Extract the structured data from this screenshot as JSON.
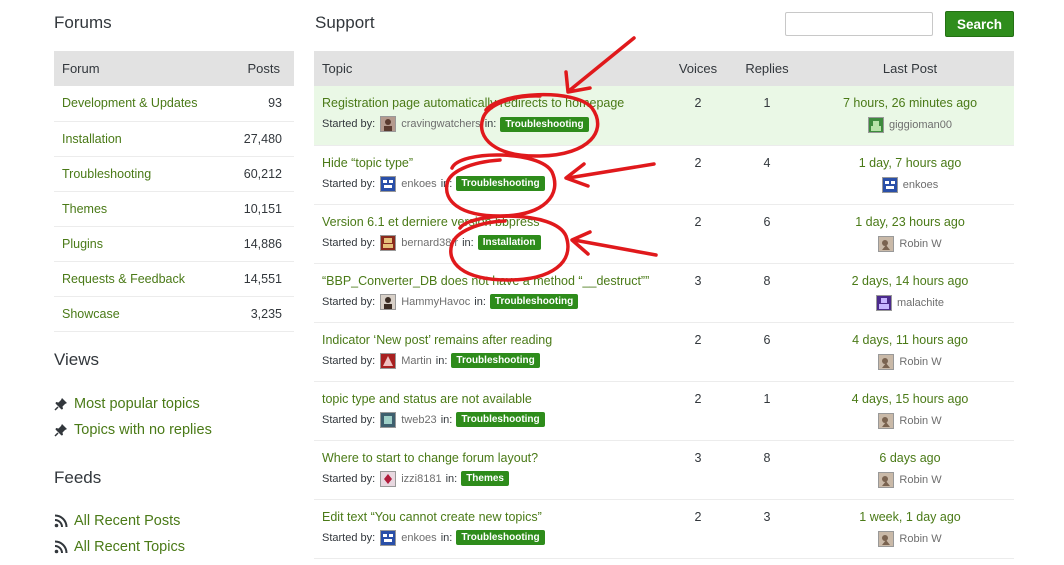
{
  "sidebar": {
    "forums_heading": "Forums",
    "forum_table": {
      "col_forum": "Forum",
      "col_posts": "Posts",
      "rows": [
        {
          "name": "Development & Updates",
          "posts": "93"
        },
        {
          "name": "Installation",
          "posts": "27,480"
        },
        {
          "name": "Troubleshooting",
          "posts": "60,212"
        },
        {
          "name": "Themes",
          "posts": "10,151"
        },
        {
          "name": "Plugins",
          "posts": "14,886"
        },
        {
          "name": "Requests & Feedback",
          "posts": "14,551"
        },
        {
          "name": "Showcase",
          "posts": "3,235"
        }
      ]
    },
    "views_heading": "Views",
    "views": [
      {
        "label": "Most popular topics",
        "icon": "pin-icon"
      },
      {
        "label": "Topics with no replies",
        "icon": "pin-icon"
      }
    ],
    "feeds_heading": "Feeds",
    "feeds": [
      {
        "label": "All Recent Posts",
        "icon": "rss-icon"
      },
      {
        "label": "All Recent Topics",
        "icon": "rss-icon"
      }
    ]
  },
  "main": {
    "title": "Support",
    "search": {
      "placeholder": "",
      "button_label": "Search"
    },
    "topic_table": {
      "col_topic": "Topic",
      "col_voices": "Voices",
      "col_replies": "Replies",
      "col_last": "Last Post",
      "started_label": "Started by:",
      "in_label": "in:",
      "rows": [
        {
          "title": "Registration page automatically redirects to homepage",
          "author": "cravingwatchers",
          "forum": "Troubleshooting",
          "voices": "2",
          "replies": "1",
          "freshness": "7 hours, 26 minutes ago",
          "last_user": "giggioman00"
        },
        {
          "title": "Hide “topic type”",
          "author": "enkoes",
          "forum": "Troubleshooting",
          "voices": "2",
          "replies": "4",
          "freshness": "1 day, 7 hours ago",
          "last_user": "enkoes"
        },
        {
          "title": "Version 6.1 et derniere version bbpress",
          "author": "bernard38fr",
          "forum": "Installation",
          "voices": "2",
          "replies": "6",
          "freshness": "1 day, 23 hours ago",
          "last_user": "Robin W"
        },
        {
          "title": "“BBP_Converter_DB does not have a method “__destruct””",
          "author": "HammyHavoc",
          "forum": "Troubleshooting",
          "voices": "3",
          "replies": "8",
          "freshness": "2 days, 14 hours ago",
          "last_user": "malachite"
        },
        {
          "title": "Indicator ‘New post’ remains after reading",
          "author": "Martin",
          "forum": "Troubleshooting",
          "voices": "2",
          "replies": "6",
          "freshness": "4 days, 11 hours ago",
          "last_user": "Robin W"
        },
        {
          "title": "topic type and status are not available",
          "author": "tweb23",
          "forum": "Troubleshooting",
          "voices": "2",
          "replies": "1",
          "freshness": "4 days, 15 hours ago",
          "last_user": "Robin W"
        },
        {
          "title": "Where to start to change forum layout?",
          "author": "izzi8181",
          "forum": "Themes",
          "voices": "3",
          "replies": "8",
          "freshness": "6 days ago",
          "last_user": "Robin W"
        },
        {
          "title": "Edit text “You cannot create new topics”",
          "author": "enkoes",
          "forum": "Troubleshooting",
          "voices": "2",
          "replies": "3",
          "freshness": "1 week, 1 day ago",
          "last_user": "Robin W"
        }
      ]
    }
  },
  "colors": {
    "link": "#4a7a17",
    "badge": "#2e8c1b",
    "search_button": "#2f8d1c",
    "highlight_row": "#eaf8e6",
    "header_bg": "#e2e2e2",
    "annotation": "#e0191c"
  }
}
